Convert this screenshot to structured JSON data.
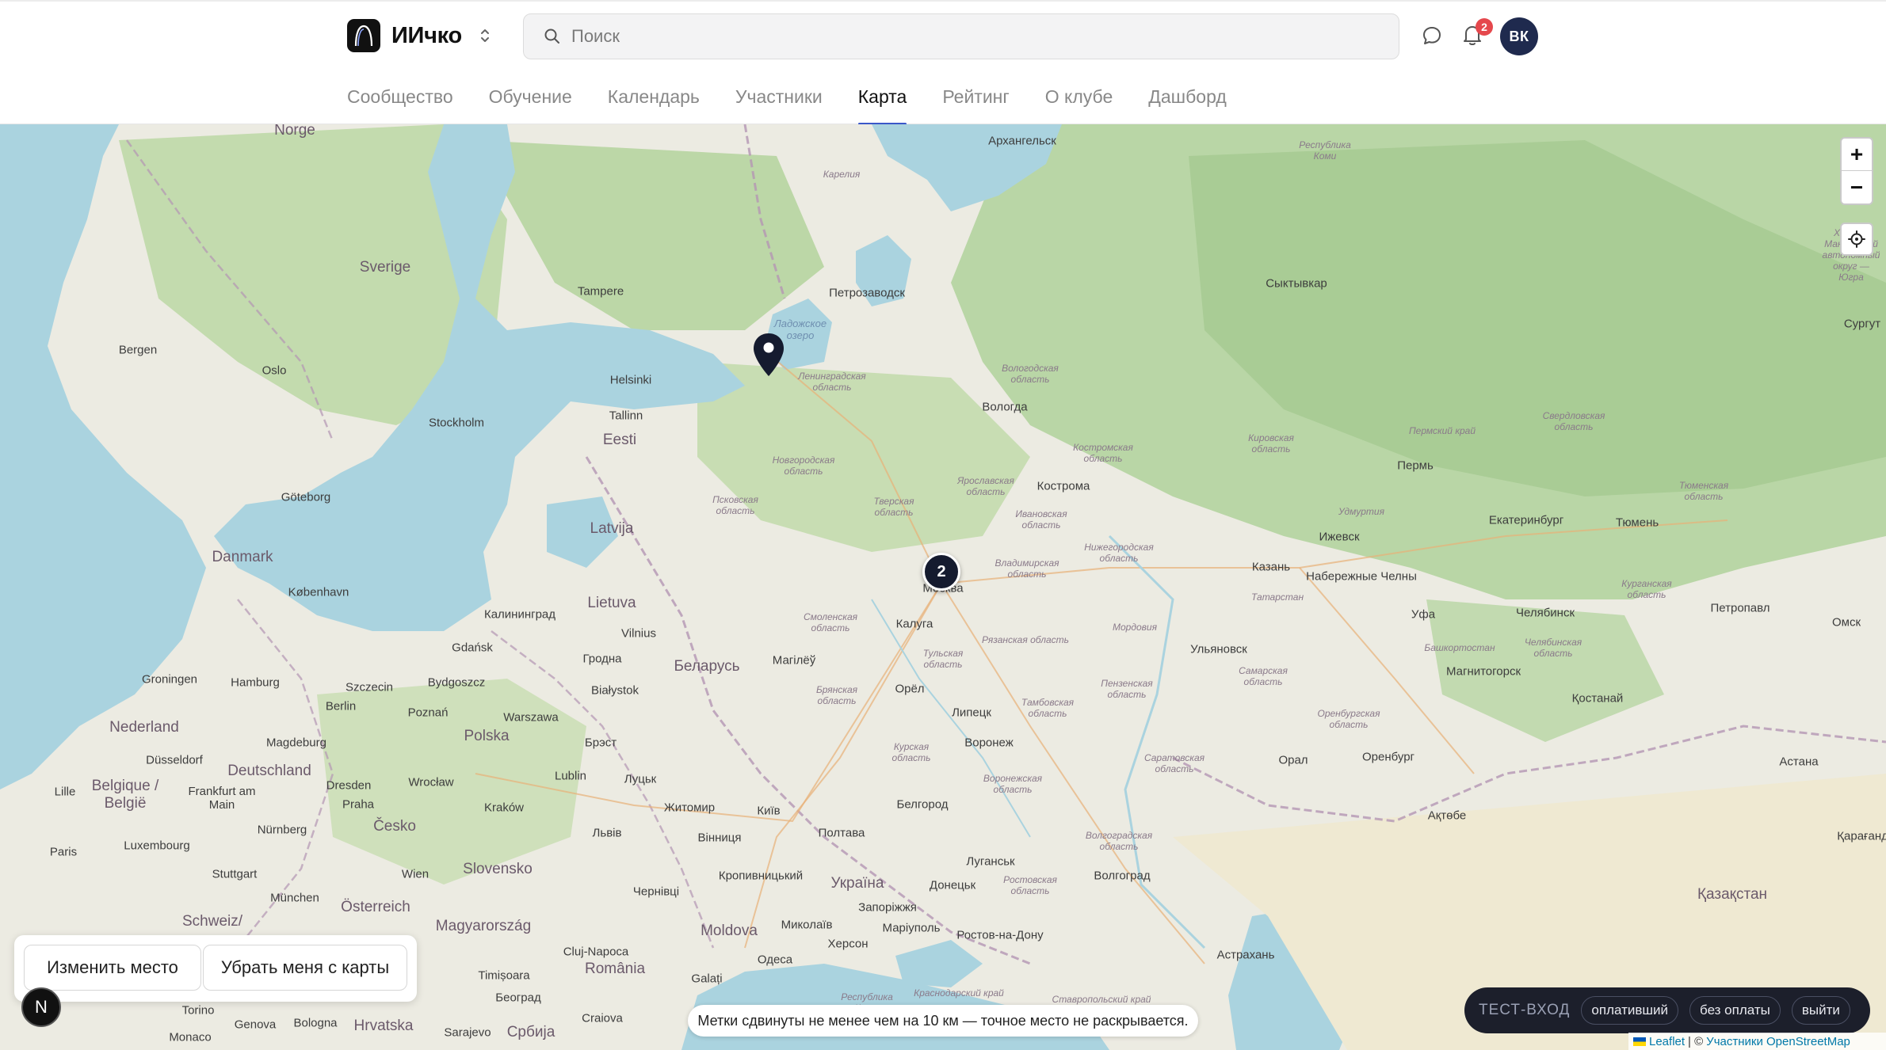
{
  "app": {
    "name": "ИИчко"
  },
  "search": {
    "placeholder": "Поиск"
  },
  "notifications": {
    "count": "2"
  },
  "user": {
    "initials": "ВК"
  },
  "nav": {
    "tabs": [
      {
        "label": "Сообщество"
      },
      {
        "label": "Обучение"
      },
      {
        "label": "Календарь"
      },
      {
        "label": "Участники"
      },
      {
        "label": "Карта",
        "active": true
      },
      {
        "label": "Рейтинг"
      },
      {
        "label": "О клубе"
      },
      {
        "label": "Дашборд"
      }
    ]
  },
  "map": {
    "zoom_in": "+",
    "zoom_out": "−",
    "cluster_count": "2",
    "places": {
      "arkhangelsk": "Архангельск",
      "petrozavodsk": "Петрозаводск",
      "syktyvkar": "Сыктывкар",
      "vologda": "Вологда",
      "kostroma": "Кострома",
      "moskva": "Москва",
      "kaluga": "Калуга",
      "orel": "Орёл",
      "lipetsk": "Липецк",
      "voronezh": "Воронеж",
      "belgorod": "Белгород",
      "perm": "Пермь",
      "ekaterinburg": "Екатеринбург",
      "tyumen": "Тюмень",
      "izhevsk": "Ижевск",
      "kazan": "Казань",
      "nab_chelny": "Набережные Челны",
      "ufa": "Уфа",
      "chelyabinsk": "Челябинск",
      "magnitogorsk": "Магнитогорск",
      "ulyanovsk": "Ульяновск",
      "orenburg": "Оренбург",
      "volgograd": "Волгоград",
      "astrakhan": "Астрахань",
      "rostov": "Ростов-на-Дону",
      "surgut": "Сургут",
      "petropavl": "Петропавл",
      "omsk": "Омск",
      "kostanay": "Қостанай",
      "astana": "Астана",
      "aktobe": "Ақтөбе",
      "oral": "Орал",
      "karagandy": "Қарағанды",
      "kazakhstan": "Қазақстан",
      "helsinki": "Helsinki",
      "tallinn": "Tallinn",
      "tampere": "Tampere",
      "stockholm": "Stockholm",
      "oslo": "Oslo",
      "bergen": "Bergen",
      "goteborg": "Göteborg",
      "kobenhavn": "København",
      "sverige": "Sverige",
      "norge": "Norge",
      "danmark": "Danmark",
      "eesti": "Eesti",
      "latvija": "Latvija",
      "lietuva": "Lietuva",
      "kaliningrad": "Калининград",
      "vilnius": "Vilnius",
      "grodna": "Гродна",
      "belarus": "Беларусь",
      "magilyou": "Магілёў",
      "gdansk": "Gdańsk",
      "bydgoszcz": "Bydgoszcz",
      "szczecin": "Szczecin",
      "bialystok": "Białystok",
      "polska": "Polska",
      "warszawa": "Warszawa",
      "poznan": "Poznań",
      "brest": "Брэст",
      "lublin": "Lublin",
      "lutsk": "Луцьк",
      "zhytomyr": "Житомир",
      "kyiv": "Київ",
      "lviv": "Львів",
      "poltava": "Полтава",
      "vinnytsia": "Вінниця",
      "kropyvnytskyi": "Кропивницький",
      "ukraina": "Україна",
      "zaporizhzhia": "Запоріжжя",
      "donetsk": "Донецьк",
      "luhansk": "Луганськ",
      "mariupol": "Маріуполь",
      "mykolaiv": "Миколаїв",
      "kherson": "Херсон",
      "odesa": "Одеса",
      "chernivtsi": "Чернівці",
      "moldova": "Moldova",
      "romania": "România",
      "cluj": "Cluj-Napoca",
      "galati": "Galați",
      "craiova": "Craiova",
      "beograd": "Београд",
      "srbija": "Србија",
      "sarajevo": "Sarajevo",
      "timisoara": "Timișoara",
      "magyarorszag": "Magyarország",
      "slovensko": "Slovensko",
      "wien": "Wien",
      "osterreich": "Österreich",
      "cesko": "Česko",
      "praha": "Praha",
      "krakow": "Kraków",
      "wroclaw": "Wrocław",
      "berlin": "Berlin",
      "hamburg": "Hamburg",
      "dresden": "Dresden",
      "deutschland": "Deutschland",
      "magdeburg": "Magdeburg",
      "frankfurt": "Frankfurt am Main",
      "nurnberg": "Nürnberg",
      "munchen": "München",
      "stuttgart": "Stuttgart",
      "dusseldorf": "Düsseldorf",
      "nederland": "Nederland",
      "groningen": "Groningen",
      "belgique": "Belgique / België",
      "luxembourg": "Luxembourg",
      "paris": "Paris",
      "lille": "Lille",
      "schweiz": "Schweiz/",
      "genova": "Genova",
      "bologna": "Bologna",
      "torino": "Torino",
      "monaco": "Monaco",
      "hrvatska": "Hrvatska"
    },
    "regions": {
      "leningrad": "Ленинградская область",
      "vologda_obl": "Вологодская область",
      "novgorod": "Новгородская область",
      "pskov": "Псковская область",
      "tver": "Тверская область",
      "yaroslavl": "Ярославская область",
      "kostroma_obl": "Костромская область",
      "ivanovo": "Ивановская область",
      "vladimir": "Владимирская область",
      "smolensk": "Смоленская область",
      "tula": "Тульская область",
      "ryazan": "Рязанская область",
      "bryansk": "Брянская область",
      "kursk": "Курская область",
      "tambov": "Тамбовская область",
      "voronezh_obl": "Воронежская область",
      "penza": "Пензенская область",
      "saratov": "Саратовская область",
      "volgograd_obl": "Волгоградская область",
      "rostov_obl": "Ростовская область",
      "samara": "Самарская область",
      "orenburg_obl": "Оренбургская область",
      "bashkortostan": "Башкортостан",
      "tatarstan": "Татарстан",
      "udmurtia": "Удмуртия",
      "kirov": "Кировская область",
      "perm_krai": "Пермский край",
      "sverdlovsk": "Свердловская область",
      "kurgan": "Курганская область",
      "chelyabinsk_obl": "Челябинская область",
      "tyumen_obl": "Тюменская область",
      "komi": "Республика Коми",
      "nizhny": "Нижегородская область",
      "mordovia": "Мордовия",
      "karelia": "Карелия",
      "krasnodar": "Краснодарский край",
      "stavropol": "Ставропольский край",
      "crimea": "Республика Крым",
      "khanty": "Ханты-Мансийский автономный округ — Югра"
    },
    "water": {
      "ladoga": "Ладожское озеро"
    }
  },
  "actions": {
    "change_place": "Изменить место",
    "remove_me": "Убрать меня с карты"
  },
  "badge_letter": "N",
  "notice": "Метки сдвинуты не менее чем на 10 км — точное место не раскрывается.",
  "testbar": {
    "label": "ТЕСТ-ВХОД",
    "chips": [
      "оплативший",
      "без оплаты",
      "выйти"
    ]
  },
  "attribution": {
    "leaflet": "Leaflet",
    "separator": "| ©",
    "osm": "Участники OpenStreetMap"
  },
  "colors": {
    "accent": "#3a57c9",
    "badge": "#e5484d",
    "avatar": "#1f2a4e",
    "sea": "#aad3df",
    "land": "#ecebe2",
    "forest": "#add19e"
  }
}
